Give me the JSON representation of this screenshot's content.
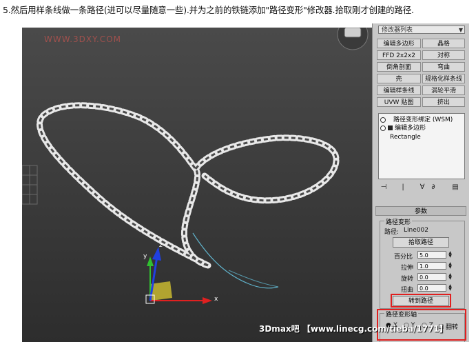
{
  "caption": "5.然后用样条线做一条路径(进可以尽量随意一些).并为之前的铁链添加\"路径变形\"修改器.拾取刚才创建的路径.",
  "watermark_top": "WWW.3DXY.COM",
  "watermark_bottom": "3Dmax吧 【www.linecg.com/tieba/1771】",
  "viewport": {
    "axis_labels": {
      "x": "x",
      "y": "y",
      "z": "z"
    },
    "colors": {
      "chain": "#f2f2f2",
      "path": "#5fb0c8",
      "x_axis": "#e02020",
      "y_axis": "#30c030",
      "z_axis": "#2040e0",
      "gizmo": "#d8c830"
    }
  },
  "panel": {
    "modifier_list": "修改器列表",
    "buttons": [
      {
        "label": "编辑多边形"
      },
      {
        "label": "晶格"
      },
      {
        "label": "FFD 2x2x2"
      },
      {
        "label": "对称"
      },
      {
        "label": "倒角剖面"
      },
      {
        "label": "弯曲"
      },
      {
        "label": "壳"
      },
      {
        "label": "规格化样条线"
      },
      {
        "label": "编辑样条线"
      },
      {
        "label": "涡轮平滑"
      },
      {
        "label": "UVW 贴图"
      },
      {
        "label": "挤出"
      }
    ],
    "stack": [
      {
        "label": "路径变形绑定 (WSM)",
        "icon": "bulb-icon"
      },
      {
        "label": "编辑多边形",
        "icon": "bulb-icon"
      },
      {
        "label": "Rectangle",
        "icon": ""
      }
    ],
    "params_title": "参数",
    "path_group_title": "路径变形",
    "path_label": "路径:",
    "path_value": "Line002",
    "pick_path": "拾取路径",
    "fields": [
      {
        "label": "百分比",
        "value": "5.0"
      },
      {
        "label": "拉伸",
        "value": "1.0"
      },
      {
        "label": "旋转",
        "value": "0.0"
      },
      {
        "label": "扭曲",
        "value": "0.0"
      }
    ],
    "move_to_path": "转到路径",
    "axis_group_title": "路径变形轴",
    "axis_options": [
      {
        "label": "X"
      },
      {
        "label": "Y"
      },
      {
        "label": "Z"
      }
    ],
    "flip_label": "翻转",
    "highlight_color": "#e02020"
  }
}
